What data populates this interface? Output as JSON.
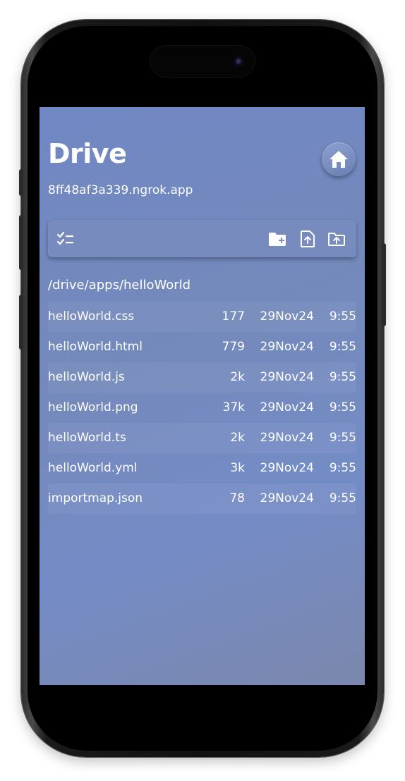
{
  "app": {
    "title": "Drive",
    "host": "8ff48af3a339.ngrok.app"
  },
  "toolbar": {
    "select_icon": "checklist-icon",
    "new_folder_icon": "folder-plus-icon",
    "upload_file_icon": "file-upload-icon",
    "upload_folder_icon": "folder-upload-icon"
  },
  "home_icon": "home-icon",
  "current_path": "/drive/apps/helloWorld",
  "files": [
    {
      "name": "helloWorld.css",
      "size": "177",
      "date": "29Nov24",
      "time": "9:55"
    },
    {
      "name": "helloWorld.html",
      "size": "779",
      "date": "29Nov24",
      "time": "9:55"
    },
    {
      "name": "helloWorld.js",
      "size": "2k",
      "date": "29Nov24",
      "time": "9:55"
    },
    {
      "name": "helloWorld.png",
      "size": "37k",
      "date": "29Nov24",
      "time": "9:55"
    },
    {
      "name": "helloWorld.ts",
      "size": "2k",
      "date": "29Nov24",
      "time": "9:55"
    },
    {
      "name": "helloWorld.yml",
      "size": "3k",
      "date": "29Nov24",
      "time": "9:55"
    },
    {
      "name": "importmap.json",
      "size": "78",
      "date": "29Nov24",
      "time": "9:55"
    }
  ],
  "colors": {
    "screen_bg": "#7088c4",
    "text": "#ffffff",
    "toolbar_bg": "#788cbe"
  }
}
